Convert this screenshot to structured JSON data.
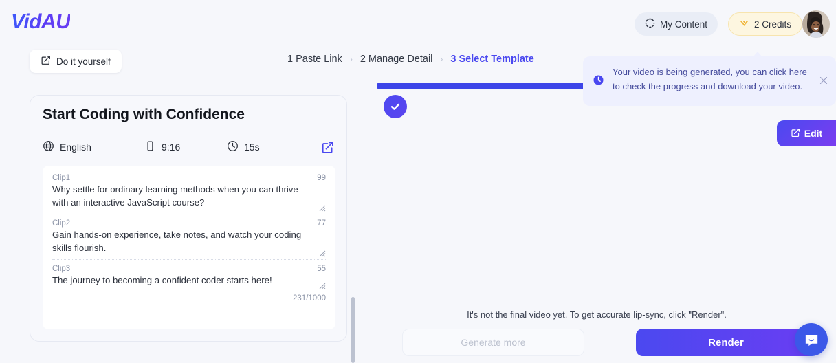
{
  "brand": {
    "logo_text": "VidAU"
  },
  "header": {
    "my_content_label": "My Content",
    "my_content_icon": "loading-spinner-icon",
    "credits_label": "2 Credits",
    "credits_icon": "diamond-icon",
    "avatar_icon": "user-avatar",
    "accent_color": "#4a48f0",
    "credits_bg": "#fdf6e0"
  },
  "subheader": {
    "diy_label": "Do it yourself",
    "diy_icon": "edit-square-icon",
    "breadcrumb": [
      {
        "label": "1 Paste Link",
        "active": false
      },
      {
        "label": "2 Manage Detail",
        "active": false
      },
      {
        "label": "3 Select Template",
        "active": true
      }
    ],
    "separator": "›"
  },
  "script_card": {
    "title": "Start Coding with Confidence",
    "language": "English",
    "language_icon": "globe-icon",
    "aspect_ratio": "9:16",
    "aspect_icon": "phone-portrait-icon",
    "duration": "15s",
    "duration_icon": "clock-icon",
    "edit_icon": "edit-square-icon",
    "clips": [
      {
        "label": "Clip1",
        "count": "99",
        "text": "Why settle for ordinary learning methods when you can thrive with an interactive JavaScript course?"
      },
      {
        "label": "Clip2",
        "count": "77",
        "text": " Gain hands-on experience, take notes, and watch your coding skills flourish."
      },
      {
        "label": "Clip3",
        "count": "55",
        "text": " The journey to becoming a confident coder starts here!"
      }
    ],
    "char_total": "231/1000"
  },
  "preview": {
    "check_icon": "check-circle-icon",
    "edit_label": "Edit",
    "edit_icon": "edit-square-icon",
    "progress_color": "#3d45e8"
  },
  "tooltip": {
    "icon": "clock-icon",
    "text": "Your video is being generated, you can click here to check the progress and download your video.",
    "close_icon": "close-icon",
    "bg_color": "#eef0fe",
    "text_color": "#454b9c"
  },
  "footer": {
    "note": "It's not the final video yet, To get accurate lip-sync, click \"Render\".",
    "generate_more_label": "Generate more",
    "render_label": "Render"
  },
  "chat": {
    "icon": "chat-bubble-icon",
    "color": "#3b58e8"
  }
}
